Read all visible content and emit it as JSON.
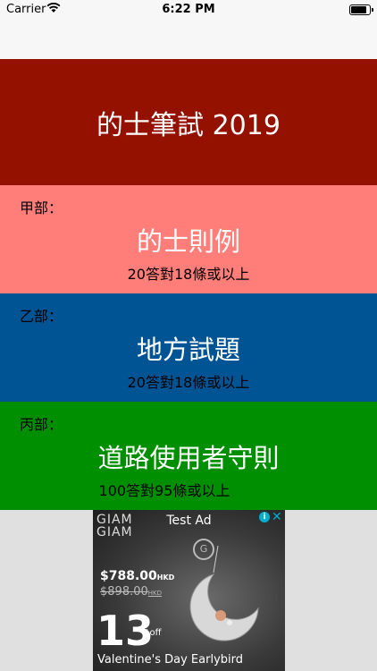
{
  "status_bar": {
    "carrier": "Carrier",
    "time": "6:22 PM",
    "battery_level": 0.95
  },
  "header": {
    "title": "的士筆試 2019",
    "color": "#941100"
  },
  "sections": [
    {
      "label": "甲部：",
      "title": "的士則例",
      "subtitle": "20答對18條或以上",
      "color": "#ff7e79"
    },
    {
      "label": "乙部：",
      "title": "地方試題",
      "subtitle": "20答對18條或以上",
      "color": "#005493"
    },
    {
      "label": "丙部：",
      "title": "道路使用者守則",
      "subtitle": "100答對95條或以上",
      "color": "#008f00"
    }
  ],
  "ad": {
    "label": "Test Ad",
    "brand_line1": "GIAM",
    "brand_line2": "GIAM",
    "info_icon": "info-icon",
    "close_icon": "close-icon",
    "price": "$788.00",
    "price_currency": "HKD",
    "old_price": "$898.00",
    "old_price_currency": "HKD",
    "percent": "13",
    "percent_suffix": "%off",
    "offer": "Valentine's Day Earlybird"
  }
}
